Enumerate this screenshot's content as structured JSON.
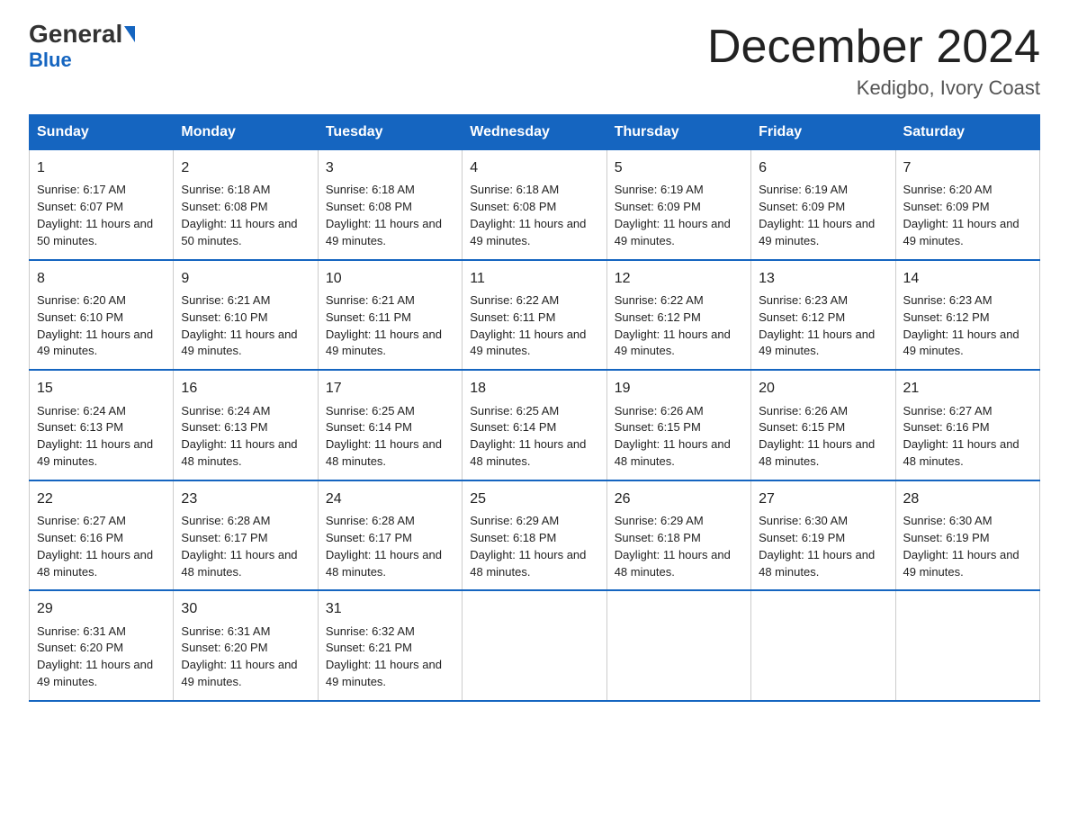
{
  "header": {
    "logo_general": "General",
    "logo_blue": "Blue",
    "month_title": "December 2024",
    "location": "Kedigbo, Ivory Coast"
  },
  "days_header": [
    "Sunday",
    "Monday",
    "Tuesday",
    "Wednesday",
    "Thursday",
    "Friday",
    "Saturday"
  ],
  "weeks": [
    [
      {
        "day": "1",
        "sunrise": "6:17 AM",
        "sunset": "6:07 PM",
        "daylight": "11 hours and 50 minutes."
      },
      {
        "day": "2",
        "sunrise": "6:18 AM",
        "sunset": "6:08 PM",
        "daylight": "11 hours and 50 minutes."
      },
      {
        "day": "3",
        "sunrise": "6:18 AM",
        "sunset": "6:08 PM",
        "daylight": "11 hours and 49 minutes."
      },
      {
        "day": "4",
        "sunrise": "6:18 AM",
        "sunset": "6:08 PM",
        "daylight": "11 hours and 49 minutes."
      },
      {
        "day": "5",
        "sunrise": "6:19 AM",
        "sunset": "6:09 PM",
        "daylight": "11 hours and 49 minutes."
      },
      {
        "day": "6",
        "sunrise": "6:19 AM",
        "sunset": "6:09 PM",
        "daylight": "11 hours and 49 minutes."
      },
      {
        "day": "7",
        "sunrise": "6:20 AM",
        "sunset": "6:09 PM",
        "daylight": "11 hours and 49 minutes."
      }
    ],
    [
      {
        "day": "8",
        "sunrise": "6:20 AM",
        "sunset": "6:10 PM",
        "daylight": "11 hours and 49 minutes."
      },
      {
        "day": "9",
        "sunrise": "6:21 AM",
        "sunset": "6:10 PM",
        "daylight": "11 hours and 49 minutes."
      },
      {
        "day": "10",
        "sunrise": "6:21 AM",
        "sunset": "6:11 PM",
        "daylight": "11 hours and 49 minutes."
      },
      {
        "day": "11",
        "sunrise": "6:22 AM",
        "sunset": "6:11 PM",
        "daylight": "11 hours and 49 minutes."
      },
      {
        "day": "12",
        "sunrise": "6:22 AM",
        "sunset": "6:12 PM",
        "daylight": "11 hours and 49 minutes."
      },
      {
        "day": "13",
        "sunrise": "6:23 AM",
        "sunset": "6:12 PM",
        "daylight": "11 hours and 49 minutes."
      },
      {
        "day": "14",
        "sunrise": "6:23 AM",
        "sunset": "6:12 PM",
        "daylight": "11 hours and 49 minutes."
      }
    ],
    [
      {
        "day": "15",
        "sunrise": "6:24 AM",
        "sunset": "6:13 PM",
        "daylight": "11 hours and 49 minutes."
      },
      {
        "day": "16",
        "sunrise": "6:24 AM",
        "sunset": "6:13 PM",
        "daylight": "11 hours and 48 minutes."
      },
      {
        "day": "17",
        "sunrise": "6:25 AM",
        "sunset": "6:14 PM",
        "daylight": "11 hours and 48 minutes."
      },
      {
        "day": "18",
        "sunrise": "6:25 AM",
        "sunset": "6:14 PM",
        "daylight": "11 hours and 48 minutes."
      },
      {
        "day": "19",
        "sunrise": "6:26 AM",
        "sunset": "6:15 PM",
        "daylight": "11 hours and 48 minutes."
      },
      {
        "day": "20",
        "sunrise": "6:26 AM",
        "sunset": "6:15 PM",
        "daylight": "11 hours and 48 minutes."
      },
      {
        "day": "21",
        "sunrise": "6:27 AM",
        "sunset": "6:16 PM",
        "daylight": "11 hours and 48 minutes."
      }
    ],
    [
      {
        "day": "22",
        "sunrise": "6:27 AM",
        "sunset": "6:16 PM",
        "daylight": "11 hours and 48 minutes."
      },
      {
        "day": "23",
        "sunrise": "6:28 AM",
        "sunset": "6:17 PM",
        "daylight": "11 hours and 48 minutes."
      },
      {
        "day": "24",
        "sunrise": "6:28 AM",
        "sunset": "6:17 PM",
        "daylight": "11 hours and 48 minutes."
      },
      {
        "day": "25",
        "sunrise": "6:29 AM",
        "sunset": "6:18 PM",
        "daylight": "11 hours and 48 minutes."
      },
      {
        "day": "26",
        "sunrise": "6:29 AM",
        "sunset": "6:18 PM",
        "daylight": "11 hours and 48 minutes."
      },
      {
        "day": "27",
        "sunrise": "6:30 AM",
        "sunset": "6:19 PM",
        "daylight": "11 hours and 48 minutes."
      },
      {
        "day": "28",
        "sunrise": "6:30 AM",
        "sunset": "6:19 PM",
        "daylight": "11 hours and 49 minutes."
      }
    ],
    [
      {
        "day": "29",
        "sunrise": "6:31 AM",
        "sunset": "6:20 PM",
        "daylight": "11 hours and 49 minutes."
      },
      {
        "day": "30",
        "sunrise": "6:31 AM",
        "sunset": "6:20 PM",
        "daylight": "11 hours and 49 minutes."
      },
      {
        "day": "31",
        "sunrise": "6:32 AM",
        "sunset": "6:21 PM",
        "daylight": "11 hours and 49 minutes."
      },
      null,
      null,
      null,
      null
    ]
  ]
}
